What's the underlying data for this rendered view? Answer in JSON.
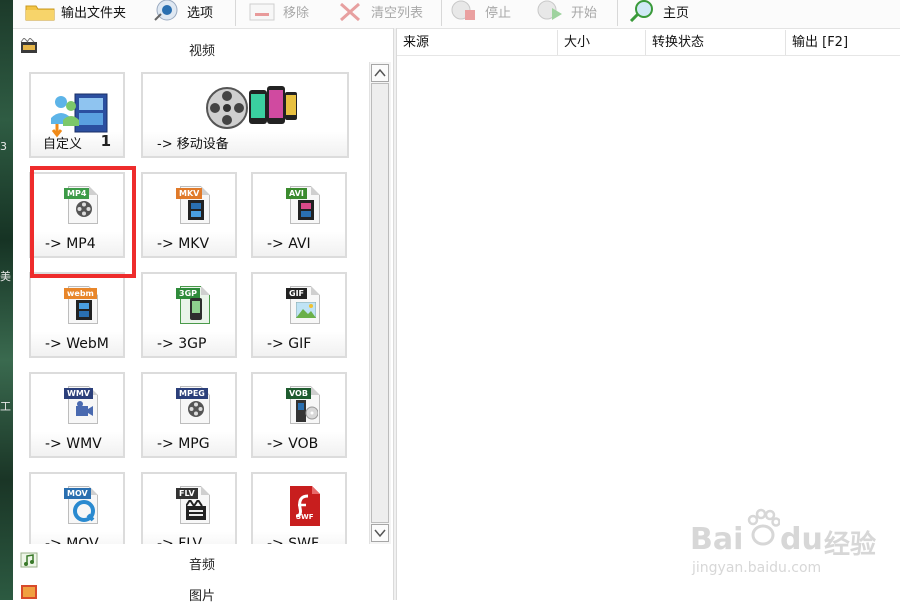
{
  "desktop_strip": {
    "chars": [
      "3",
      "美",
      "工"
    ]
  },
  "toolbar": {
    "items": [
      {
        "label": "输出文件夹",
        "icon": "folder-icon",
        "enabled": true
      },
      {
        "label": "选项",
        "icon": "options-icon",
        "enabled": true
      },
      {
        "label": "移除",
        "icon": "remove-icon",
        "enabled": false
      },
      {
        "label": "清空列表",
        "icon": "clear-list-icon",
        "enabled": false
      },
      {
        "label": "停止",
        "icon": "stop-icon",
        "enabled": false
      },
      {
        "label": "开始",
        "icon": "start-icon",
        "enabled": false
      },
      {
        "label": "主页",
        "icon": "home-icon",
        "enabled": true
      }
    ]
  },
  "categories": {
    "video": "视频",
    "audio": "音频",
    "picture": "图片"
  },
  "tiles": [
    {
      "label": "自定义",
      "badge": "1",
      "icon": "custom-icon"
    },
    {
      "label": "-> 移动设备",
      "icon": "mobile-devices-icon"
    },
    {
      "label": "-> MP4",
      "tag": "MP4",
      "tag_color": "#3d9b48",
      "icon": "mp4-file-icon",
      "selected": true
    },
    {
      "label": "-> MKV",
      "tag": "MKV",
      "tag_color": "#e07a2a",
      "icon": "mkv-file-icon"
    },
    {
      "label": "-> AVI",
      "tag": "AVI",
      "tag_color": "#3b8b2e",
      "icon": "avi-file-icon"
    },
    {
      "label": "-> WebM",
      "tag": "webm",
      "tag_color": "#e8862a",
      "icon": "webm-file-icon"
    },
    {
      "label": "-> 3GP",
      "tag": "3GP",
      "tag_color": "#2e8b3a",
      "icon": "3gp-file-icon"
    },
    {
      "label": "-> GIF",
      "tag": "GIF",
      "tag_color": "#222222",
      "icon": "gif-file-icon"
    },
    {
      "label": "-> WMV",
      "tag": "WMV",
      "tag_color": "#2b3f7a",
      "icon": "wmv-file-icon"
    },
    {
      "label": "-> MPG",
      "tag": "MPEG",
      "tag_color": "#2b3f7a",
      "icon": "mpg-file-icon"
    },
    {
      "label": "-> VOB",
      "tag": "VOB",
      "tag_color": "#1e5b2e",
      "icon": "vob-file-icon"
    },
    {
      "label": "-> MOV",
      "tag": "MOV",
      "tag_color": "#2a6fb0",
      "icon": "mov-file-icon"
    },
    {
      "label": "-> FLV",
      "tag": "FLV",
      "tag_color": "#333333",
      "icon": "flv-file-icon"
    },
    {
      "label": "-> SWF",
      "tag": "SWF",
      "tag_color": "#c81e1e",
      "icon": "swf-file-icon"
    }
  ],
  "file_list": {
    "columns": [
      "来源",
      "大小",
      "转换状态",
      "输出 [F2]"
    ]
  },
  "watermark": {
    "brand": "Bai",
    "brand_end": "du",
    "suffix": "经验",
    "url": "jingyan.baidu.com"
  },
  "colors": {
    "selection": "#ee2c2c",
    "accent_blue": "#2a6fb0"
  }
}
